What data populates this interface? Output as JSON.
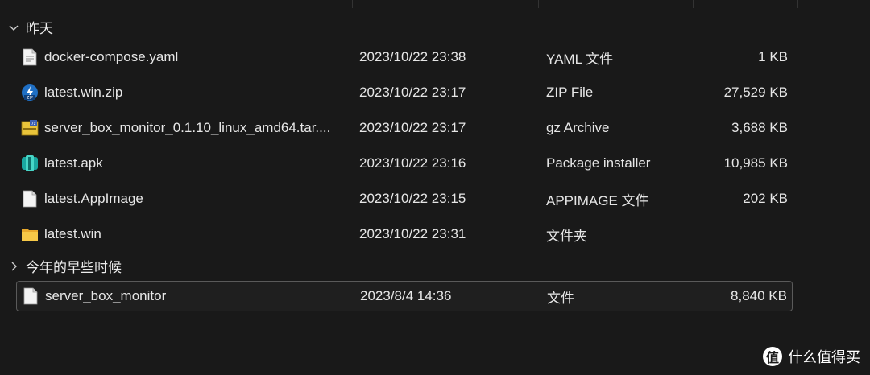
{
  "groups": [
    {
      "label": "昨天",
      "files": [
        {
          "name": "docker-compose.yaml",
          "date": "2023/10/22 23:38",
          "type": "YAML 文件",
          "size": "1 KB",
          "icon": "yaml-file-icon"
        },
        {
          "name": "latest.win.zip",
          "date": "2023/10/22 23:17",
          "type": "ZIP File",
          "size": "27,529 KB",
          "icon": "zip-archive-icon"
        },
        {
          "name": "server_box_monitor_0.1.10_linux_amd64.tar....",
          "date": "2023/10/22 23:17",
          "type": "gz Archive",
          "size": "3,688 KB",
          "icon": "gz-archive-icon"
        },
        {
          "name": "latest.apk",
          "date": "2023/10/22 23:16",
          "type": "Package installer",
          "size": "10,985 KB",
          "icon": "package-installer-icon"
        },
        {
          "name": "latest.AppImage",
          "date": "2023/10/22 23:15",
          "type": "APPIMAGE 文件",
          "size": "202 KB",
          "icon": "file-icon"
        },
        {
          "name": "latest.win",
          "date": "2023/10/22 23:31",
          "type": "文件夹",
          "size": "",
          "icon": "folder-icon"
        }
      ]
    },
    {
      "label": "今年的早些时候",
      "files": [
        {
          "name": "server_box_monitor",
          "date": "2023/8/4 14:36",
          "type": "文件",
          "size": "8,840 KB",
          "icon": "file-icon",
          "selected": true
        }
      ]
    }
  ],
  "watermark": {
    "logo_char": "值",
    "text": "什么值得买"
  }
}
